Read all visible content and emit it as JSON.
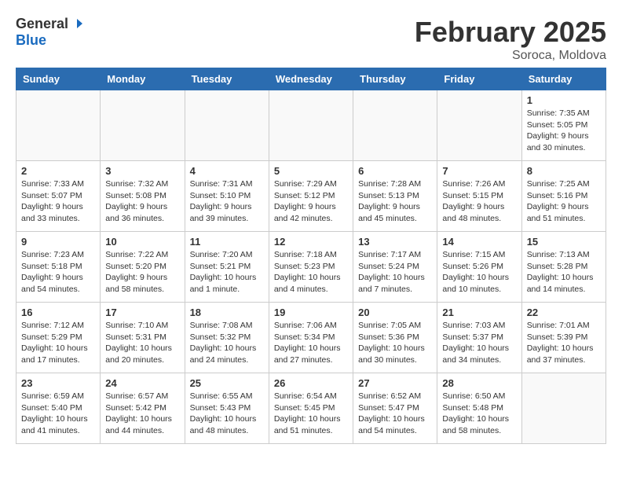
{
  "header": {
    "logo_general": "General",
    "logo_blue": "Blue",
    "month_title": "February 2025",
    "location": "Soroca, Moldova"
  },
  "weekdays": [
    "Sunday",
    "Monday",
    "Tuesday",
    "Wednesday",
    "Thursday",
    "Friday",
    "Saturday"
  ],
  "weeks": [
    [
      {
        "day": "",
        "info": ""
      },
      {
        "day": "",
        "info": ""
      },
      {
        "day": "",
        "info": ""
      },
      {
        "day": "",
        "info": ""
      },
      {
        "day": "",
        "info": ""
      },
      {
        "day": "",
        "info": ""
      },
      {
        "day": "1",
        "info": "Sunrise: 7:35 AM\nSunset: 5:05 PM\nDaylight: 9 hours and 30 minutes."
      }
    ],
    [
      {
        "day": "2",
        "info": "Sunrise: 7:33 AM\nSunset: 5:07 PM\nDaylight: 9 hours and 33 minutes."
      },
      {
        "day": "3",
        "info": "Sunrise: 7:32 AM\nSunset: 5:08 PM\nDaylight: 9 hours and 36 minutes."
      },
      {
        "day": "4",
        "info": "Sunrise: 7:31 AM\nSunset: 5:10 PM\nDaylight: 9 hours and 39 minutes."
      },
      {
        "day": "5",
        "info": "Sunrise: 7:29 AM\nSunset: 5:12 PM\nDaylight: 9 hours and 42 minutes."
      },
      {
        "day": "6",
        "info": "Sunrise: 7:28 AM\nSunset: 5:13 PM\nDaylight: 9 hours and 45 minutes."
      },
      {
        "day": "7",
        "info": "Sunrise: 7:26 AM\nSunset: 5:15 PM\nDaylight: 9 hours and 48 minutes."
      },
      {
        "day": "8",
        "info": "Sunrise: 7:25 AM\nSunset: 5:16 PM\nDaylight: 9 hours and 51 minutes."
      }
    ],
    [
      {
        "day": "9",
        "info": "Sunrise: 7:23 AM\nSunset: 5:18 PM\nDaylight: 9 hours and 54 minutes."
      },
      {
        "day": "10",
        "info": "Sunrise: 7:22 AM\nSunset: 5:20 PM\nDaylight: 9 hours and 58 minutes."
      },
      {
        "day": "11",
        "info": "Sunrise: 7:20 AM\nSunset: 5:21 PM\nDaylight: 10 hours and 1 minute."
      },
      {
        "day": "12",
        "info": "Sunrise: 7:18 AM\nSunset: 5:23 PM\nDaylight: 10 hours and 4 minutes."
      },
      {
        "day": "13",
        "info": "Sunrise: 7:17 AM\nSunset: 5:24 PM\nDaylight: 10 hours and 7 minutes."
      },
      {
        "day": "14",
        "info": "Sunrise: 7:15 AM\nSunset: 5:26 PM\nDaylight: 10 hours and 10 minutes."
      },
      {
        "day": "15",
        "info": "Sunrise: 7:13 AM\nSunset: 5:28 PM\nDaylight: 10 hours and 14 minutes."
      }
    ],
    [
      {
        "day": "16",
        "info": "Sunrise: 7:12 AM\nSunset: 5:29 PM\nDaylight: 10 hours and 17 minutes."
      },
      {
        "day": "17",
        "info": "Sunrise: 7:10 AM\nSunset: 5:31 PM\nDaylight: 10 hours and 20 minutes."
      },
      {
        "day": "18",
        "info": "Sunrise: 7:08 AM\nSunset: 5:32 PM\nDaylight: 10 hours and 24 minutes."
      },
      {
        "day": "19",
        "info": "Sunrise: 7:06 AM\nSunset: 5:34 PM\nDaylight: 10 hours and 27 minutes."
      },
      {
        "day": "20",
        "info": "Sunrise: 7:05 AM\nSunset: 5:36 PM\nDaylight: 10 hours and 30 minutes."
      },
      {
        "day": "21",
        "info": "Sunrise: 7:03 AM\nSunset: 5:37 PM\nDaylight: 10 hours and 34 minutes."
      },
      {
        "day": "22",
        "info": "Sunrise: 7:01 AM\nSunset: 5:39 PM\nDaylight: 10 hours and 37 minutes."
      }
    ],
    [
      {
        "day": "23",
        "info": "Sunrise: 6:59 AM\nSunset: 5:40 PM\nDaylight: 10 hours and 41 minutes."
      },
      {
        "day": "24",
        "info": "Sunrise: 6:57 AM\nSunset: 5:42 PM\nDaylight: 10 hours and 44 minutes."
      },
      {
        "day": "25",
        "info": "Sunrise: 6:55 AM\nSunset: 5:43 PM\nDaylight: 10 hours and 48 minutes."
      },
      {
        "day": "26",
        "info": "Sunrise: 6:54 AM\nSunset: 5:45 PM\nDaylight: 10 hours and 51 minutes."
      },
      {
        "day": "27",
        "info": "Sunrise: 6:52 AM\nSunset: 5:47 PM\nDaylight: 10 hours and 54 minutes."
      },
      {
        "day": "28",
        "info": "Sunrise: 6:50 AM\nSunset: 5:48 PM\nDaylight: 10 hours and 58 minutes."
      },
      {
        "day": "",
        "info": ""
      }
    ]
  ]
}
